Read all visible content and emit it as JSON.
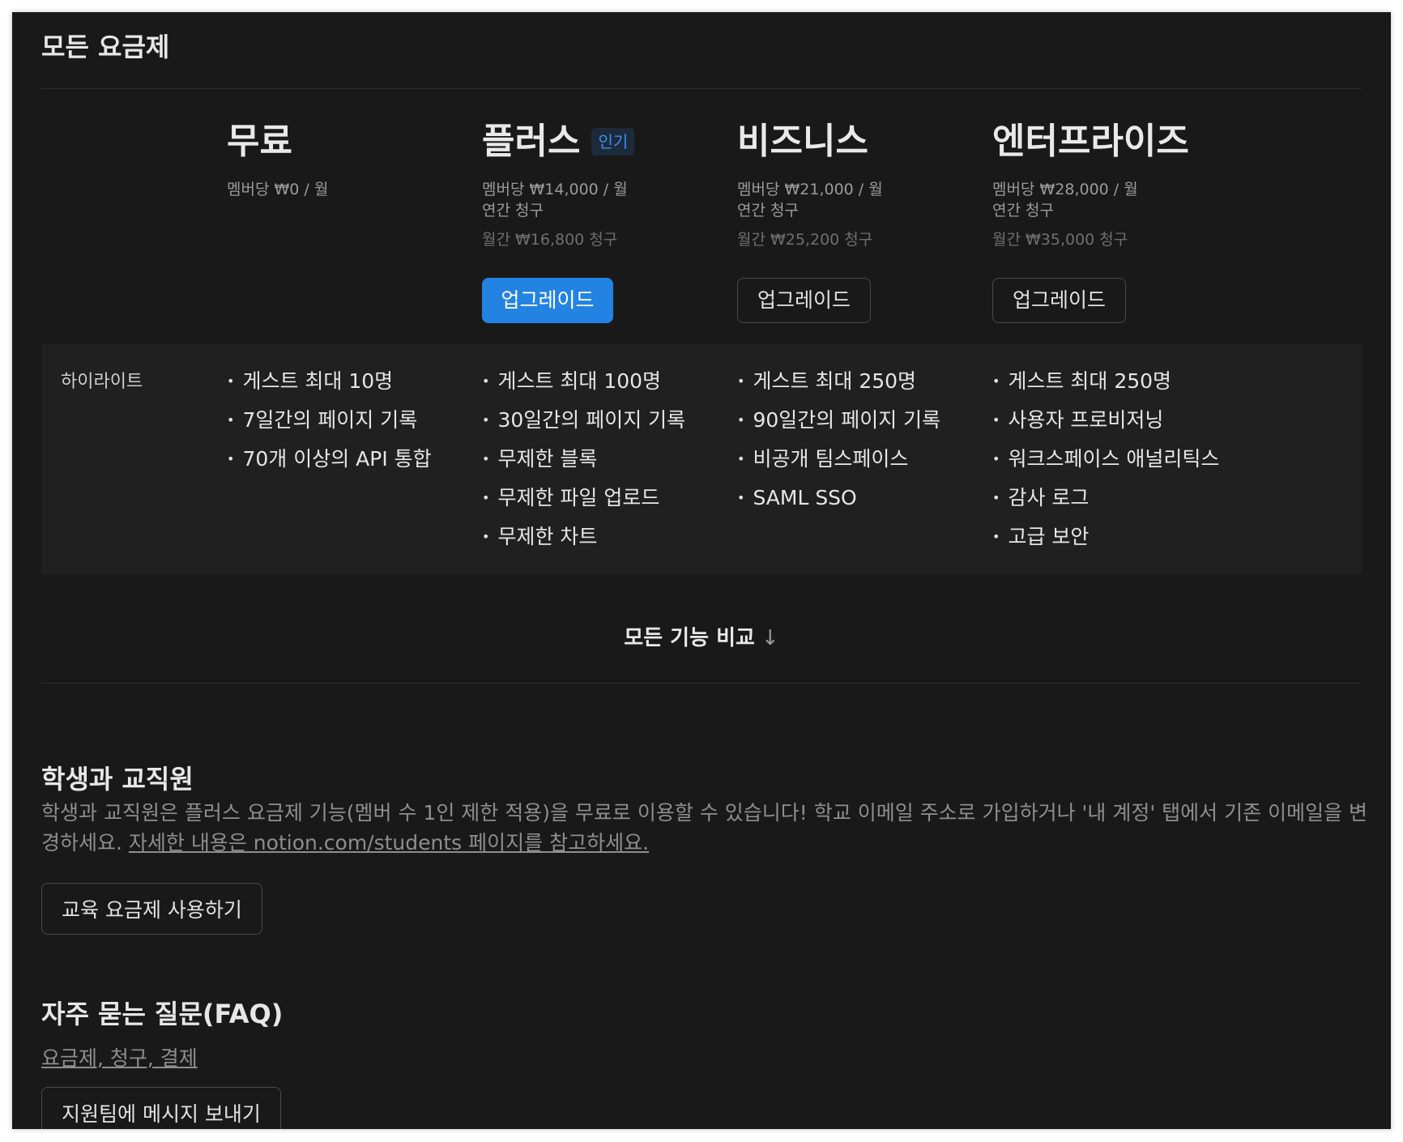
{
  "page": {
    "title": "모든 요금제"
  },
  "plans": [
    {
      "name": "무료",
      "price": "멤버당 ₩0 / 월"
    },
    {
      "name": "플러스",
      "badge": "인기",
      "price": "멤버당 ₩14,000 / 월",
      "billing": "연간 청구",
      "monthly": "월간 ₩16,800 청구",
      "button": "업그레이드"
    },
    {
      "name": "비즈니스",
      "price": "멤버당 ₩21,000 / 월",
      "billing": "연간 청구",
      "monthly": "월간 ₩25,200 청구",
      "button": "업그레이드"
    },
    {
      "name": "엔터프라이즈",
      "price": "멤버당 ₩28,000 / 월",
      "billing": "연간 청구",
      "monthly": "월간 ₩35,000 청구",
      "button": "업그레이드"
    }
  ],
  "highlights": {
    "label": "하이라이트",
    "free": [
      "게스트 최대 10명",
      "7일간의 페이지 기록",
      "70개 이상의 API 통합"
    ],
    "plus": [
      "게스트 최대 100명",
      "30일간의 페이지 기록",
      "무제한 블록",
      "무제한 파일 업로드",
      "무제한 차트"
    ],
    "business": [
      "게스트 최대 250명",
      "90일간의 페이지 기록",
      "비공개 팀스페이스",
      "SAML SSO"
    ],
    "enterprise": [
      "게스트 최대 250명",
      "사용자 프로비저닝",
      "워크스페이스 애널리틱스",
      "감사 로그",
      "고급 보안"
    ]
  },
  "compare": {
    "label": "모든 기능 비교",
    "arrow": "↓"
  },
  "students": {
    "title": "학생과 교직원",
    "desc": "학생과 교직원은 플러스 요금제 기능(멤버 수 1인 제한 적용)을 무료로 이용할 수 있습니다! 학교 이메일 주소로 가입하거나 '내 계정' 탭에서 기존 이메일을 변경하세요. ",
    "link": "자세한 내용은 notion.com/students 페이지를 참고하세요.",
    "button": "교육 요금제 사용하기"
  },
  "faq": {
    "title": "자주 묻는 질문(FAQ)",
    "link": "요금제, 청구, 결제",
    "button": "지원팀에 메시지 보내기"
  },
  "colors": {
    "accent": "#2383e2",
    "background": "#191919",
    "panel": "#202020",
    "badge": "#3b8fee"
  }
}
